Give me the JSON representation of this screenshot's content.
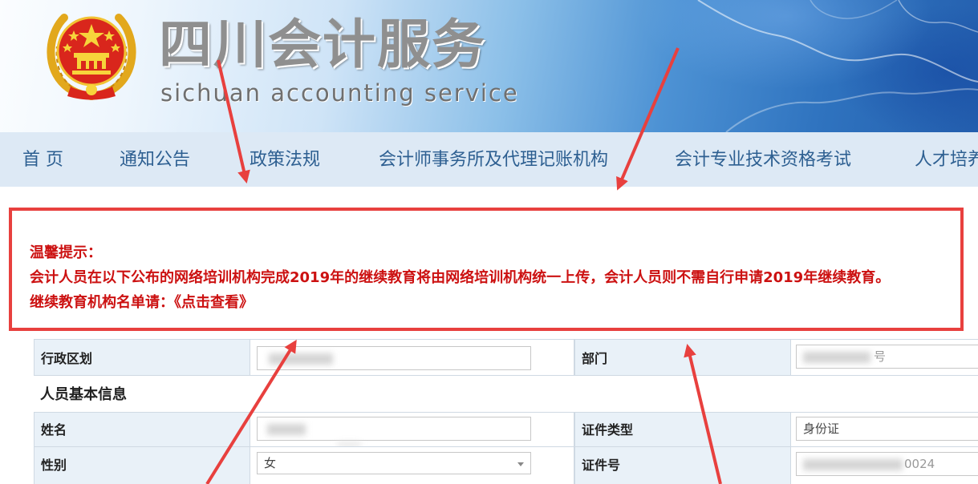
{
  "header": {
    "title": "四川会计服务",
    "subtitle": "sichuan accounting service",
    "emblem_icon": "national-emblem-icon"
  },
  "nav": {
    "items": [
      {
        "label": "首 页"
      },
      {
        "label": "通知公告"
      },
      {
        "label": "政策法规"
      },
      {
        "label": "会计师事务所及代理记账机构"
      },
      {
        "label": "会计专业技术资格考试"
      },
      {
        "label": "人才培养"
      }
    ]
  },
  "notice": {
    "title": "温馨提示：",
    "body": "会计人员在以下公布的网络培训机构完成2019年的继续教育将由网络培训机构统一上传，会计人员则不需自行申请2019年继续教育。",
    "list_prefix": "继续教育机构名单请：",
    "list_link": "《点击查看》"
  },
  "form": {
    "region_label": "行政区划",
    "department_label": "部门",
    "department_value_suffix": "号",
    "section_title": "人员基本信息",
    "name_label": "姓名",
    "id_type_label": "证件类型",
    "id_type_value": "身份证",
    "gender_label": "性别",
    "gender_value": "女",
    "id_number_label": "证件号",
    "id_number_value_suffix": "0024"
  },
  "colors": {
    "nav_background": "#dde9f5",
    "nav_text": "#2d5f91",
    "notice_border": "#e8403e",
    "notice_text": "#cc1111",
    "arrow": "#e8403e",
    "label_background": "#e9f1f8"
  }
}
